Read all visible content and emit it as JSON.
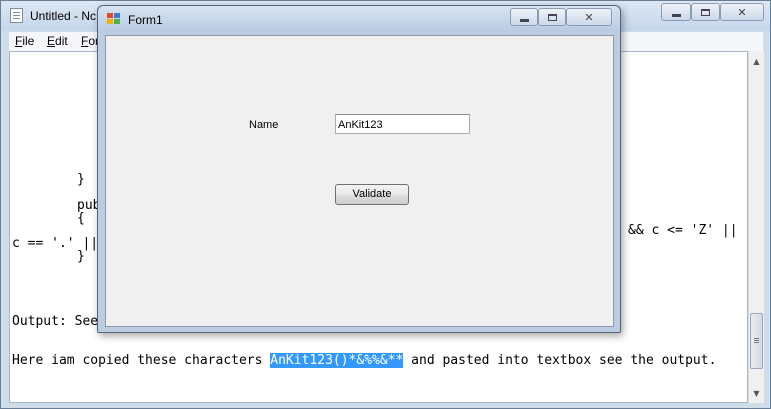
{
  "notepad": {
    "title": "Untitled - Nc",
    "menu": [
      {
        "key": "F",
        "rest": "ile"
      },
      {
        "key": "E",
        "rest": "dit"
      },
      {
        "key": "F",
        "rest": "or"
      }
    ],
    "lines": {
      "l1": "}",
      "l2": "pub",
      "l3": "{",
      "l4a": "c == '.' ||",
      "l4b": "&& c <= 'Z' ||",
      "l5": "}",
      "l6": "Output: See",
      "l7_before": "Here iam copied these characters ",
      "l7_selected": "AnKit123()*&%%&**",
      "l7_after": " and pasted into textbox see the output."
    }
  },
  "form1": {
    "title": "Form1",
    "name_label": "Name",
    "name_value": "AnKit123",
    "validate_label": "Validate"
  }
}
